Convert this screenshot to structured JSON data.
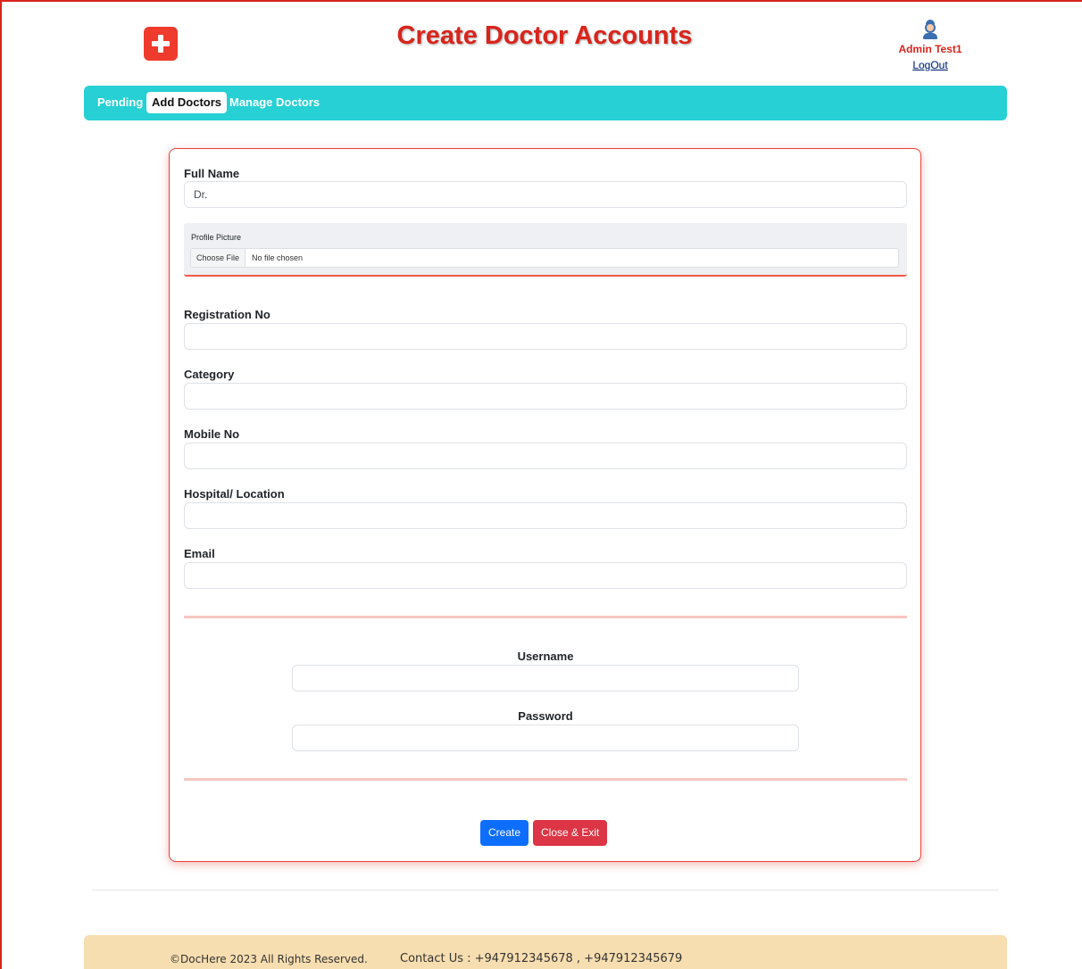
{
  "header": {
    "logo_icon": "medical-cross-icon",
    "title": "Create Doctor Accounts",
    "user_icon": "doctor-avatar-icon",
    "user_name": "Admin Test1",
    "logout_label": "LogOut"
  },
  "nav": {
    "items": [
      {
        "label": "Pending",
        "active": false
      },
      {
        "label": "Add Doctors",
        "active": true
      },
      {
        "label": "Manage Doctors",
        "active": false
      }
    ]
  },
  "form": {
    "full_name": {
      "label": "Full Name",
      "value": "Dr."
    },
    "profile_picture": {
      "label": "Profile Picture",
      "button_label": "Choose File",
      "status": "No file chosen"
    },
    "registration_no": {
      "label": "Registration No",
      "value": ""
    },
    "category": {
      "label": "Category",
      "value": ""
    },
    "mobile_no": {
      "label": "Mobile No",
      "value": ""
    },
    "hospital_location": {
      "label": "Hospital/ Location",
      "value": ""
    },
    "email": {
      "label": "Email",
      "value": ""
    },
    "username": {
      "label": "Username",
      "value": ""
    },
    "password": {
      "label": "Password",
      "value": ""
    },
    "create_label": "Create",
    "close_label": "Close & Exit"
  },
  "footer": {
    "copyright": "©DocHere 2023 All Rights Reserved.",
    "contact": "Contact Us : +947912345678 , +947912345679"
  },
  "colors": {
    "brand_red": "#d9241c",
    "nav_bg": "#26d0d4",
    "footer_bg": "#f7deb0",
    "create_button": "#0d6efd",
    "close_button": "#dc3545"
  }
}
